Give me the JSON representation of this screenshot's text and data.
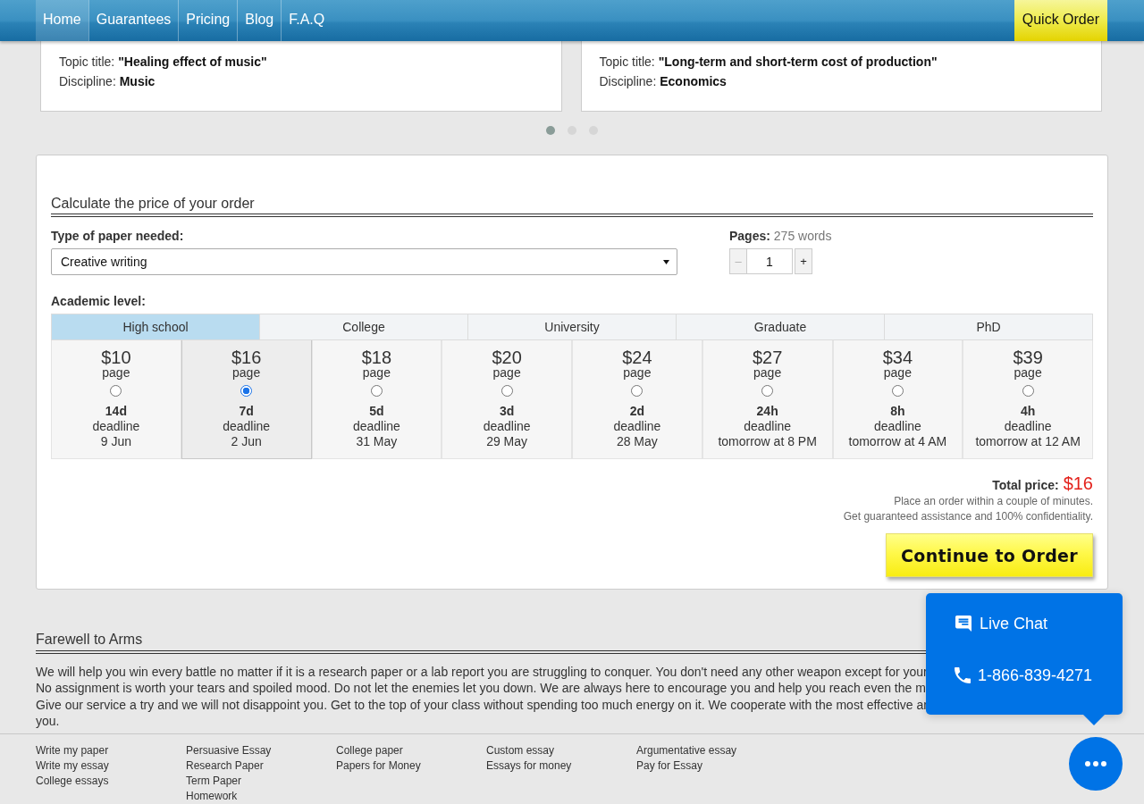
{
  "nav": {
    "items": [
      {
        "label": "Home",
        "selected": true
      },
      {
        "label": "Guarantees",
        "selected": false
      },
      {
        "label": "Pricing",
        "selected": false
      },
      {
        "label": "Blog",
        "selected": false
      },
      {
        "label": "F.A.Q",
        "selected": false
      }
    ],
    "quick_order": "Quick Order"
  },
  "testimonials": {
    "cards": [
      {
        "topic": "Topic title: **\"Healing effect of music\"**",
        "discipline": "Discipline: **Music**"
      },
      {
        "topic": "Topic title: **\"Long-term and short-term cost of production\"**",
        "discipline": "Discipline: **Economics**"
      }
    ],
    "dots": [
      {
        "selected": true
      },
      {
        "selected": false
      },
      {
        "selected": false
      }
    ]
  },
  "calculator": {
    "title": "Calculate the price of your order",
    "paper_type": {
      "label": "Type of paper needed:",
      "value": "Creative writing"
    },
    "pages": {
      "label": "**Pages:** 275 words",
      "value": "1",
      "decrement": {
        "label": "–",
        "disabled": true
      },
      "increment": {
        "label": "+",
        "disabled": false
      }
    },
    "academic_level": {
      "label": "Academic level:",
      "levels": [
        {
          "label": "High school",
          "selected": true
        },
        {
          "label": "College",
          "selected": false
        },
        {
          "label": "University",
          "selected": false
        },
        {
          "label": "Graduate",
          "selected": false
        },
        {
          "label": "PhD",
          "selected": false
        }
      ]
    },
    "deadlines": [
      {
        "price": "$10",
        "unit": "page",
        "duration": "14d",
        "caption": "deadline",
        "date": "9 Jun",
        "selected": false
      },
      {
        "price": "$16",
        "unit": "page",
        "duration": "7d",
        "caption": "deadline",
        "date": "2 Jun",
        "selected": true
      },
      {
        "price": "$18",
        "unit": "page",
        "duration": "5d",
        "caption": "deadline",
        "date": "31 May",
        "selected": false
      },
      {
        "price": "$20",
        "unit": "page",
        "duration": "3d",
        "caption": "deadline",
        "date": "29 May",
        "selected": false
      },
      {
        "price": "$24",
        "unit": "page",
        "duration": "2d",
        "caption": "deadline",
        "date": "28 May",
        "selected": false
      },
      {
        "price": "$27",
        "unit": "page",
        "duration": "24h",
        "caption": "deadline",
        "date": "tomorrow at 8 PM",
        "selected": false
      },
      {
        "price": "$34",
        "unit": "page",
        "duration": "8h",
        "caption": "deadline",
        "date": "tomorrow at 4 AM",
        "selected": false
      },
      {
        "price": "$39",
        "unit": "page",
        "duration": "4h",
        "caption": "deadline",
        "date": "tomorrow at 12 AM",
        "selected": false
      }
    ],
    "total": {
      "label": "Total price:",
      "value": "$16",
      "notes": [
        "Place an order within a couple of minutes.",
        "Get guaranteed assistance and 100% confidentiality."
      ]
    },
    "continue_button": "Continue to Order"
  },
  "article": {
    "title": "Farewell to Arms",
    "lines": [
      "We will help you win every battle no matter if it is a research paper or a lab report you are struggling to conquer. You don't need any other weapon except for your",
      "No assignment is worth your tears and spoiled mood. Do not let the enemies let you down. We are always here to encourage you and help you reach even the m",
      "Give our service a try and we will not disappoint you. Get to the top of your class without spending too much energy on it. We cooperate with the most effective ar",
      "you."
    ]
  },
  "footer": {
    "columns": [
      [
        "Write my paper",
        "Write my essay",
        "College essays"
      ],
      [
        "Persuasive Essay",
        "Research Paper",
        "Term Paper",
        "Homework"
      ],
      [
        "College paper",
        "Papers for Money"
      ],
      [
        "Custom essay",
        "Essays for money"
      ],
      [
        "Argumentative essay",
        "Pay for Essay"
      ]
    ]
  },
  "chat_widget": {
    "expanded": true,
    "options": [
      {
        "kind": "chat",
        "label": "Live Chat"
      },
      {
        "kind": "phone",
        "label": "1-866-839-4271"
      }
    ]
  }
}
